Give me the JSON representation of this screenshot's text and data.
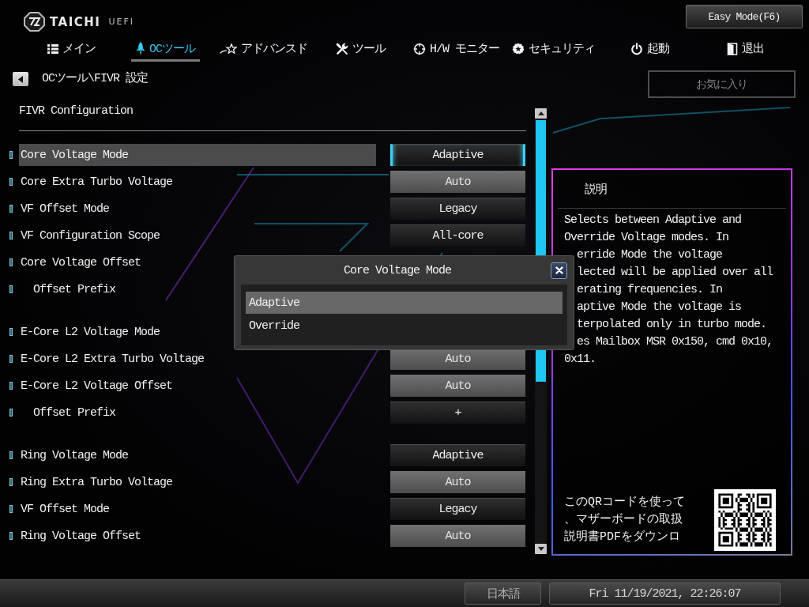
{
  "logo": {
    "name": "TAICHI",
    "suffix": "UEFI"
  },
  "easy_mode_button": {
    "label": "Easy Mode(F6)"
  },
  "tabs": [
    {
      "label": "メイン",
      "selected": false
    },
    {
      "label": "OCツール",
      "selected": true
    },
    {
      "label": "アドバンスド",
      "selected": false
    },
    {
      "label": "ツール",
      "selected": false
    },
    {
      "label": "H/W モニター",
      "selected": false
    },
    {
      "label": "セキュリティ",
      "selected": false
    },
    {
      "label": "起動",
      "selected": false
    },
    {
      "label": "退出",
      "selected": false
    }
  ],
  "breadcrumb": {
    "path": "OCツール\\FIVR 設定"
  },
  "favorites_button": {
    "label": "お気に入り",
    "disabled": true
  },
  "section_title": "FIVR Configuration",
  "setting_groups": [
    {
      "rows": [
        {
          "label": "Core Voltage Mode",
          "value": "Adaptive",
          "kind": "select",
          "selected": true
        },
        {
          "label": "Core Extra Turbo Voltage",
          "value": "Auto",
          "kind": "field",
          "selected": false
        },
        {
          "label": "VF Offset Mode",
          "value": "Legacy",
          "kind": "select",
          "selected": false
        },
        {
          "label": "VF Configuration Scope",
          "value": "All-core",
          "kind": "select",
          "selected": false
        },
        {
          "label": "Core Voltage Offset",
          "selected": false,
          "children": [
            {
              "label": "Offset Prefix",
              "selected": false
            }
          ]
        }
      ]
    },
    {
      "rows": [
        {
          "label": "E-Core L2 Voltage Mode",
          "selected": false
        },
        {
          "label": "E-Core L2 Extra Turbo Voltage",
          "value": "Auto",
          "kind": "field",
          "selected": false
        },
        {
          "label": "E-Core L2 Voltage Offset",
          "value": "Auto",
          "kind": "field",
          "selected": false,
          "children": [
            {
              "label": "Offset Prefix",
              "value": "+",
              "kind": "select",
              "selected": false
            }
          ]
        }
      ]
    },
    {
      "rows": [
        {
          "label": "Ring Voltage Mode",
          "value": "Adaptive",
          "kind": "select",
          "selected": false
        },
        {
          "label": "Ring Extra Turbo Voltage",
          "value": "Auto",
          "kind": "field",
          "selected": false
        },
        {
          "label": "VF Offset Mode",
          "value": "Legacy",
          "kind": "select",
          "selected": false
        },
        {
          "label": "Ring Voltage Offset",
          "value": "Auto",
          "kind": "field",
          "selected": false
        }
      ]
    }
  ],
  "popup": {
    "title": "Core Voltage Mode",
    "options": [
      {
        "label": "Adaptive",
        "selected": true
      },
      {
        "label": "Override",
        "selected": false
      }
    ]
  },
  "help_panel": {
    "title": "説明",
    "blocks": [
      {
        "kind": "full",
        "lines": [
          "Selects between Adaptive and",
          "Override Voltage modes. In"
        ]
      },
      {
        "kind": "cut",
        "lines": [
          "erride Mode the voltage",
          "lected will be applied over all",
          "erating frequencies. In",
          "aptive Mode the voltage is",
          "terpolated only in turbo mode.",
          "es Mailbox MSR 0x150, cmd 0x10,"
        ]
      },
      {
        "kind": "full",
        "lines": [
          "0x11."
        ]
      }
    ],
    "qr_note": [
      "このQRコードを使って",
      "、マザーボードの取扱",
      "説明書PDFをダウンロ"
    ]
  },
  "status_bar": {
    "language": "日本語",
    "datetime": "Fri 11/19/2021, 22:26:07"
  }
}
